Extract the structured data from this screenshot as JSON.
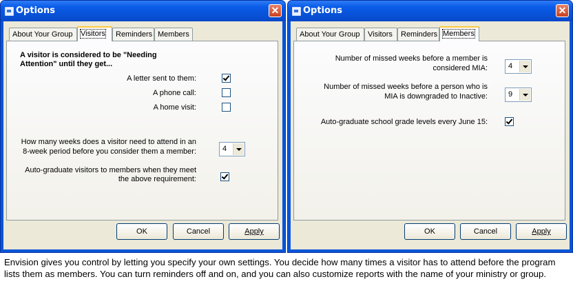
{
  "window_title": "Options",
  "close_glyph": "✕",
  "tabs": [
    "About Your Group",
    "Visitors",
    "Reminders",
    "Members"
  ],
  "buttons": {
    "ok": "OK",
    "cancel": "Cancel",
    "apply": "Apply"
  },
  "left_dialog": {
    "selected_tab": "Visitors",
    "heading_line1": "A visitor is considered to be \"Needing",
    "heading_line2": "Attention\" until they get...",
    "letter_label": "A letter sent to them:",
    "letter_checked": true,
    "phone_label": "A phone call:",
    "phone_checked": false,
    "visit_label": "A home visit:",
    "visit_checked": false,
    "weeks_q_line1": "How many weeks does a visitor need to attend in an",
    "weeks_q_line2": "8-week period before you consider them a member:",
    "weeks_value": "4",
    "autograd_line1": "Auto-graduate visitors to members when they meet",
    "autograd_line2": "the above requirement:",
    "autograd_checked": true
  },
  "right_dialog": {
    "selected_tab": "Members",
    "mia_line1": "Number of missed weeks before a member is",
    "mia_line2": "considered MIA:",
    "mia_value": "4",
    "inactive_line1": "Number of missed weeks before a person who is",
    "inactive_line2": "MIA is downgraded to Inactive:",
    "inactive_value": "9",
    "grade_label": "Auto-graduate school grade levels every June 15:",
    "grade_checked": true
  },
  "caption": "Envision gives you control by letting you specify your own settings.  You decide how many times a visitor has to attend before the program lists them as members.  You can turn reminders off and on, and you can also customize reports with the name of your ministry or group."
}
